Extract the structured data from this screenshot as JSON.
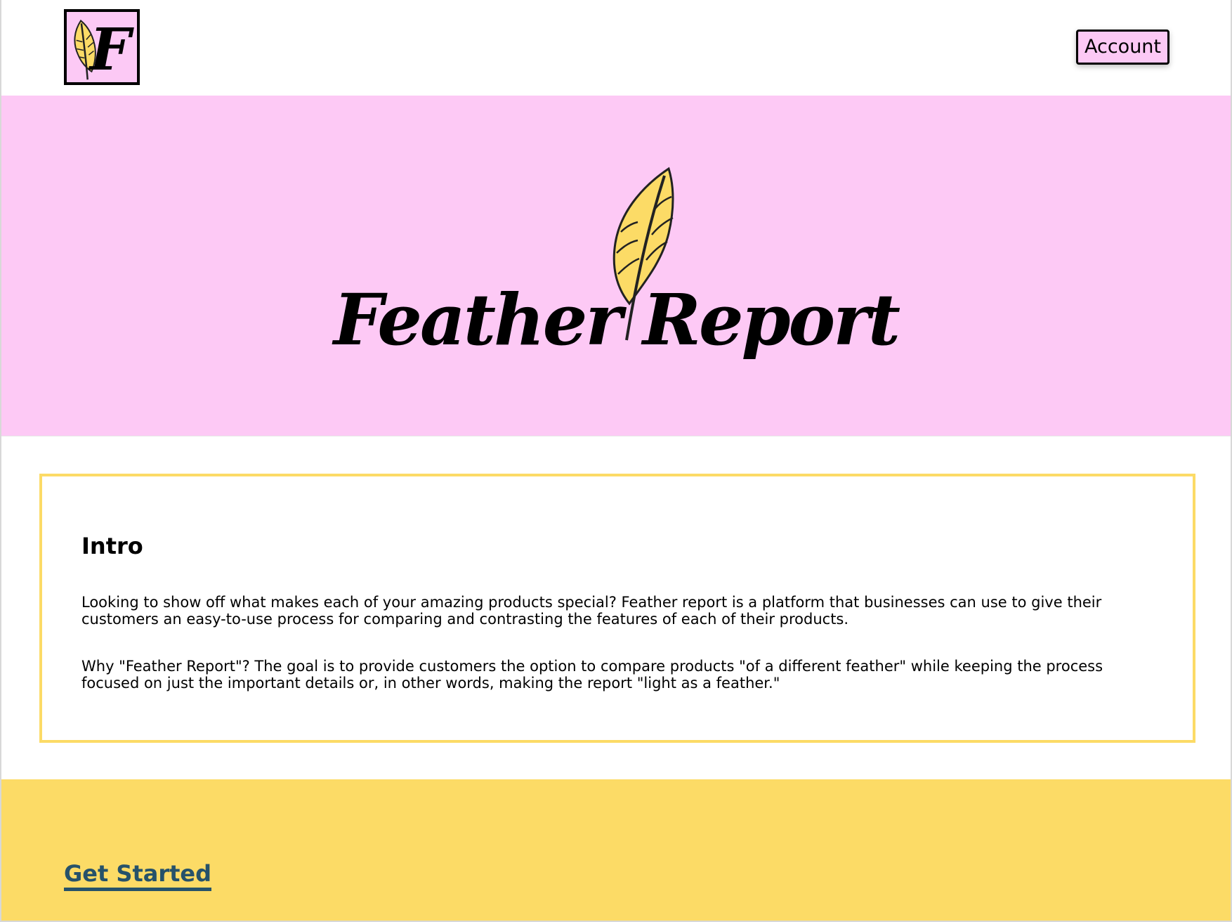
{
  "header": {
    "logo_letter": "F",
    "account_label": "Account"
  },
  "hero": {
    "wordmark": "Feather Report"
  },
  "intro": {
    "heading": "Intro",
    "paragraph_1": "Looking to show off what makes each of your amazing products special? Feather report is a platform that businesses can use to give their customers an easy-to-use process for comparing and contrasting the features of each of their products.",
    "paragraph_2": "Why \"Feather Report\"? The goal is to provide customers the option to compare products \"of a different feather\" while keeping the process focused on just the important details or, in other words, making the report \"light as a feather.\""
  },
  "footer": {
    "cta_label": "Get Started"
  },
  "colors": {
    "pink": "#fdc9f5",
    "yellow": "#fcdb66",
    "link": "#26526a"
  }
}
